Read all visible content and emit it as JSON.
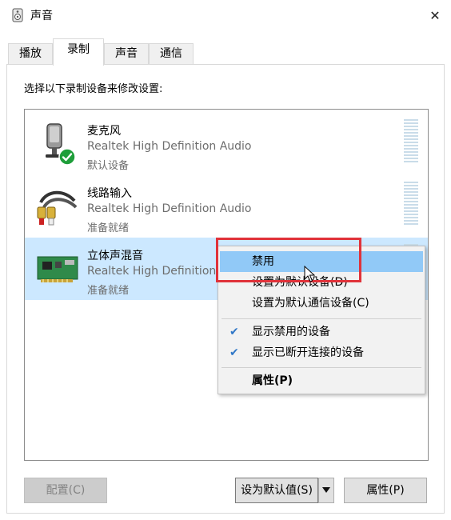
{
  "window": {
    "title": "声音",
    "close_glyph": "✕"
  },
  "tabs": [
    {
      "label": "播放",
      "active": false
    },
    {
      "label": "录制",
      "active": true
    },
    {
      "label": "声音",
      "active": false
    },
    {
      "label": "通信",
      "active": false
    }
  ],
  "instruction": "选择以下录制设备来修改设置:",
  "devices": [
    {
      "name": "麦克风",
      "driver": "Realtek High Definition Audio",
      "status": "默认设备",
      "icon": "microphone-icon",
      "default": true,
      "selected": false
    },
    {
      "name": "线路输入",
      "driver": "Realtek High Definition Audio",
      "status": "准备就绪",
      "icon": "line-in-cable-icon",
      "default": false,
      "selected": false
    },
    {
      "name": "立体声混音",
      "driver": "Realtek High Definition Audio",
      "status": "准备就绪",
      "icon": "sound-card-icon",
      "default": false,
      "selected": true
    }
  ],
  "context_menu": {
    "items": [
      {
        "label": "禁用",
        "highlighted": true,
        "checked": false,
        "bold": false
      },
      {
        "label": "设置为默认设备(D)",
        "highlighted": false,
        "checked": false,
        "bold": false
      },
      {
        "label": "设置为默认通信设备(C)",
        "highlighted": false,
        "checked": false,
        "bold": false
      },
      {
        "label": "显示禁用的设备",
        "highlighted": false,
        "checked": true,
        "bold": false
      },
      {
        "label": "显示已断开连接的设备",
        "highlighted": false,
        "checked": true,
        "bold": false
      },
      {
        "label": "属性(P)",
        "highlighted": false,
        "checked": false,
        "bold": true
      }
    ],
    "check_glyph": "✔"
  },
  "buttons": {
    "configure": "配置(C)",
    "set_default": "设为默认值(S)",
    "properties": "属性(P)"
  },
  "colors": {
    "selection": "#cce8ff",
    "menu_highlight": "#91c9f7",
    "annotation_red": "#e0323a",
    "check_green": "#1e9e3a"
  }
}
